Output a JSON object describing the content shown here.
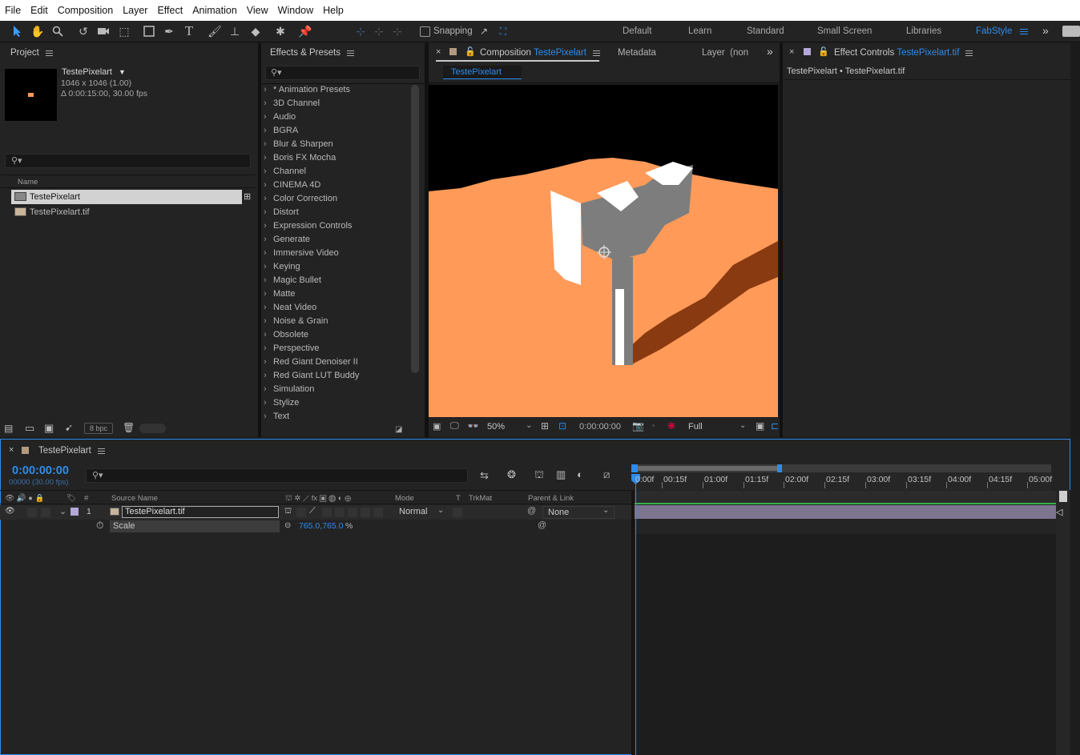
{
  "menu": [
    "File",
    "Edit",
    "Composition",
    "Layer",
    "Effect",
    "Animation",
    "View",
    "Window",
    "Help"
  ],
  "toolbar": {
    "snapping_label": "Snapping"
  },
  "workspaces": [
    {
      "label": "Default",
      "active": false
    },
    {
      "label": "Learn",
      "active": false
    },
    {
      "label": "Standard",
      "active": false
    },
    {
      "label": "Small Screen",
      "active": false
    },
    {
      "label": "Libraries",
      "active": false
    },
    {
      "label": "FabStyle",
      "active": true
    }
  ],
  "project": {
    "title": "Project",
    "comp_name": "TestePixelart",
    "dimensions": "1046 x 1046 (1.00)",
    "duration": "Δ 0:00:15:00, 30.00 fps",
    "column_name": "Name",
    "items": [
      {
        "name": "TestePixelart",
        "selected": true
      },
      {
        "name": "TestePixelart.tif",
        "selected": false
      }
    ],
    "bpc": "8 bpc"
  },
  "effects": {
    "title": "Effects & Presets",
    "items": [
      "* Animation Presets",
      "3D Channel",
      "Audio",
      "BGRA",
      "Blur & Sharpen",
      "Boris FX Mocha",
      "Channel",
      "CINEMA 4D",
      "Color Correction",
      "Distort",
      "Expression Controls",
      "Generate",
      "Immersive Video",
      "Keying",
      "Magic Bullet",
      "Matte",
      "Neat Video",
      "Noise & Grain",
      "Obsolete",
      "Perspective",
      "Red Giant Denoiser II",
      "Red Giant LUT Buddy",
      "Simulation",
      "Stylize",
      "Text"
    ]
  },
  "composition": {
    "tab_prefix": "Composition",
    "tab_name": "TestePixelart",
    "metadata_tab": "Metadata",
    "layer_tab": "Layer  (non",
    "subtab": "TestePixelart",
    "zoom": "50%",
    "timecode": "0:00:00:00",
    "resolution": "Full"
  },
  "effect_controls": {
    "tab_prefix": "Effect Controls",
    "tab_name": "TestePixelart.tif",
    "breadcrumb": "TestePixelart • TestePixelart.tif"
  },
  "timeline": {
    "tab": "TestePixelart",
    "timecode": "0:00:00:00",
    "frames": "00000 (30.00 fps)",
    "headers": {
      "num": "#",
      "source": "Source Name",
      "mode": "Mode",
      "t": "T",
      "trkmat": "TrkMat",
      "parent": "Parent & Link"
    },
    "layer": {
      "index": "1",
      "name": "TestePixelart.tif",
      "mode": "Normal",
      "parent": "None"
    },
    "property": {
      "name": "Scale",
      "value": "765.0,765.0",
      "unit": "%"
    },
    "ruler": [
      "0:00f",
      "00:15f",
      "01:00f",
      "01:15f",
      "02:00f",
      "02:15f",
      "03:00f",
      "03:15f",
      "04:00f",
      "04:15f",
      "05:00f"
    ]
  },
  "colors": {
    "accent": "#2d8ceb",
    "canvas_bg": "#ff9a59",
    "layer_bar": "#7d7590"
  }
}
